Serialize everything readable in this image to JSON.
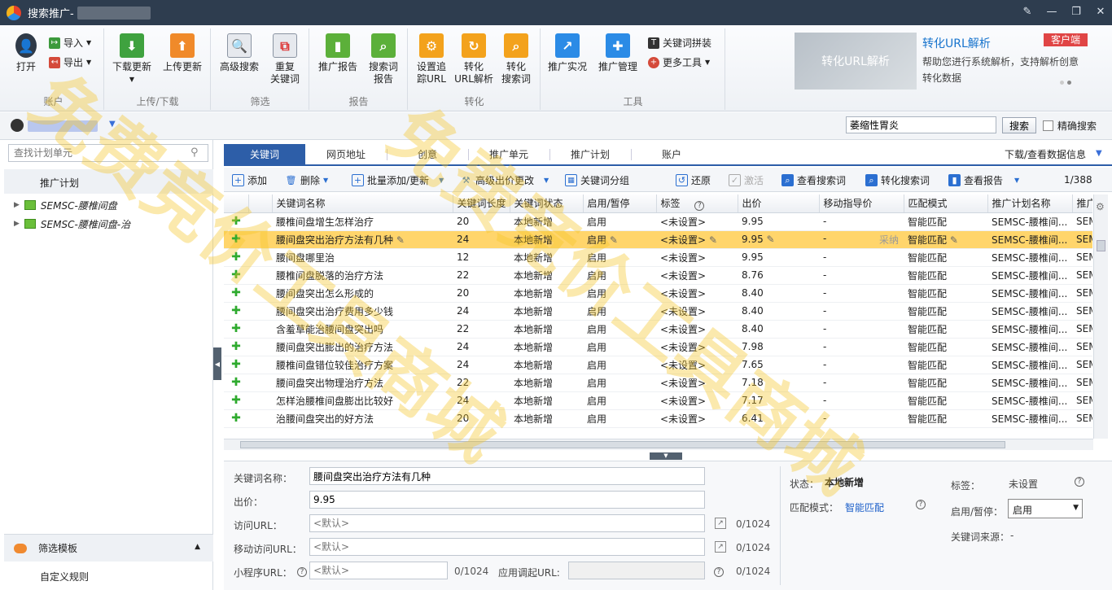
{
  "window": {
    "title": "搜索推广-"
  },
  "ribbon": {
    "account_group": {
      "label": "账户",
      "open": "打开",
      "import": "导入",
      "export": "导出"
    },
    "updown_group": {
      "label": "上传/下载",
      "download": "下载更新",
      "upload": "上传更新"
    },
    "filter_group": {
      "label": "筛选",
      "advanced": "高级搜索",
      "duplicate_l1": "重复",
      "duplicate_l2": "关键词"
    },
    "report_group": {
      "label": "报告",
      "promo_report": "推广报告",
      "search_report_l1": "搜索词",
      "search_report_l2": "报告"
    },
    "convert_group": {
      "label": "转化",
      "track_l1": "设置追",
      "track_l2": "踪URL",
      "url_parse_l1": "转化",
      "url_parse_l2": "URL解析",
      "search_word_l1": "转化",
      "search_word_l2": "搜索词"
    },
    "tools_group": {
      "label": "工具",
      "live": "推广实况",
      "manage": "推广管理",
      "kw_combine": "关键词拼装",
      "more_tools": "更多工具"
    }
  },
  "promo": {
    "image_text": "转化URL解析",
    "title": "转化URL解析",
    "badge": "客户端",
    "desc": "帮助您进行系统解析，支持解析创意转化数据"
  },
  "search": {
    "value": "萎缩性胃炎",
    "button": "搜索",
    "exact": "精确搜索"
  },
  "left": {
    "search_placeholder": "查找计划单元",
    "header": "推广计划",
    "tree": [
      "SEMSC-腰椎间盘",
      "SEMSC-腰椎间盘-治"
    ],
    "filter_template": "筛选模板",
    "custom_rule": "自定义规则"
  },
  "tabs": [
    "关键词",
    "网页地址",
    "创意",
    "推广单元",
    "推广计划",
    "账户"
  ],
  "download_info": "下载/查看数据信息",
  "toolbar": {
    "add": "添加",
    "delete": "删除",
    "batch": "批量添加/更新",
    "bid": "高级出价更改",
    "group": "关键词分组",
    "restore": "还原",
    "activate": "激活",
    "view_search": "查看搜索词",
    "convert_search": "转化搜索词",
    "view_report": "查看报告",
    "pager": "1/388"
  },
  "grid": {
    "columns": [
      "关键词名称",
      "关键词长度",
      "关键词状态",
      "启用/暂停",
      "标签",
      "出价",
      "移动指导价",
      "匹配模式",
      "推广计划名称",
      "推广"
    ],
    "adopt_label": "采纳",
    "rows": [
      {
        "kw": "腰椎间盘增生怎样治疗",
        "len": "20",
        "status": "本地新增",
        "on": "启用",
        "tag": "<未设置>",
        "bid": "9.95",
        "mbid": "-",
        "match": "智能匹配",
        "plan": "SEMSC-腰椎间...",
        "tail": "SEM"
      },
      {
        "kw": "腰间盘突出治疗方法有几种",
        "len": "24",
        "status": "本地新增",
        "on": "启用",
        "tag": "<未设置>",
        "bid": "9.95",
        "mbid": "-",
        "match": "智能匹配",
        "plan": "SEMSC-腰椎间...",
        "tail": "SEM"
      },
      {
        "kw": "腰间盘哪里治",
        "len": "12",
        "status": "本地新增",
        "on": "启用",
        "tag": "<未设置>",
        "bid": "9.95",
        "mbid": "-",
        "match": "智能匹配",
        "plan": "SEMSC-腰椎间...",
        "tail": "SEM"
      },
      {
        "kw": "腰椎间盘脱落的治疗方法",
        "len": "22",
        "status": "本地新增",
        "on": "启用",
        "tag": "<未设置>",
        "bid": "8.76",
        "mbid": "-",
        "match": "智能匹配",
        "plan": "SEMSC-腰椎间...",
        "tail": "SEM"
      },
      {
        "kw": "腰间盘突出怎么形成的",
        "len": "20",
        "status": "本地新增",
        "on": "启用",
        "tag": "<未设置>",
        "bid": "8.40",
        "mbid": "-",
        "match": "智能匹配",
        "plan": "SEMSC-腰椎间...",
        "tail": "SEM"
      },
      {
        "kw": "腰间盘突出治疗费用多少钱",
        "len": "24",
        "status": "本地新增",
        "on": "启用",
        "tag": "<未设置>",
        "bid": "8.40",
        "mbid": "-",
        "match": "智能匹配",
        "plan": "SEMSC-腰椎间...",
        "tail": "SEM"
      },
      {
        "kw": "含羞草能治腰间盘突出吗",
        "len": "22",
        "status": "本地新增",
        "on": "启用",
        "tag": "<未设置>",
        "bid": "8.40",
        "mbid": "-",
        "match": "智能匹配",
        "plan": "SEMSC-腰椎间...",
        "tail": "SEM"
      },
      {
        "kw": "腰间盘突出膨出的治疗方法",
        "len": "24",
        "status": "本地新增",
        "on": "启用",
        "tag": "<未设置>",
        "bid": "7.98",
        "mbid": "-",
        "match": "智能匹配",
        "plan": "SEMSC-腰椎间...",
        "tail": "SEM"
      },
      {
        "kw": "腰椎间盘错位较佳治疗方案",
        "len": "24",
        "status": "本地新增",
        "on": "启用",
        "tag": "<未设置>",
        "bid": "7.65",
        "mbid": "-",
        "match": "智能匹配",
        "plan": "SEMSC-腰椎间...",
        "tail": "SEM"
      },
      {
        "kw": "腰间盘突出物理治疗方法",
        "len": "22",
        "status": "本地新增",
        "on": "启用",
        "tag": "<未设置>",
        "bid": "7.18",
        "mbid": "-",
        "match": "智能匹配",
        "plan": "SEMSC-腰椎间...",
        "tail": "SEM"
      },
      {
        "kw": "怎样治腰椎间盘膨出比较好",
        "len": "24",
        "status": "本地新增",
        "on": "启用",
        "tag": "<未设置>",
        "bid": "7.17",
        "mbid": "-",
        "match": "智能匹配",
        "plan": "SEMSC-腰椎间...",
        "tail": "SEM"
      },
      {
        "kw": "治腰间盘突出的好方法",
        "len": "20",
        "status": "本地新增",
        "on": "启用",
        "tag": "<未设置>",
        "bid": "6.41",
        "mbid": "-",
        "match": "智能匹配",
        "plan": "SEMSC-腰椎间...",
        "tail": "SEM"
      }
    ]
  },
  "detail": {
    "kw_label": "关键词名称：",
    "kw_value": "腰间盘突出治疗方法有几种",
    "bid_label": "出价：",
    "bid_value": "9.95",
    "url_label": "访问URL：",
    "url_placeholder": "<默认>",
    "url_count": "0/1024",
    "murl_label": "移动访问URL：",
    "murl_placeholder": "<默认>",
    "murl_count": "0/1024",
    "mini_label": "小程序URL：",
    "mini_placeholder": "<默认>",
    "mini_count": "0/1024",
    "app_label": "应用调起URL:",
    "app_count": "0/1024",
    "status_label": "状态：",
    "status_value": "本地新增",
    "match_label": "匹配模式：",
    "match_value": "智能匹配",
    "tag_label": "标签：",
    "tag_value": "未设置",
    "onoff_label": "启用/暂停：",
    "onoff_value": "启用",
    "source_label": "关键词来源：",
    "source_value": "-"
  },
  "watermark": "免费竞价工具商城"
}
